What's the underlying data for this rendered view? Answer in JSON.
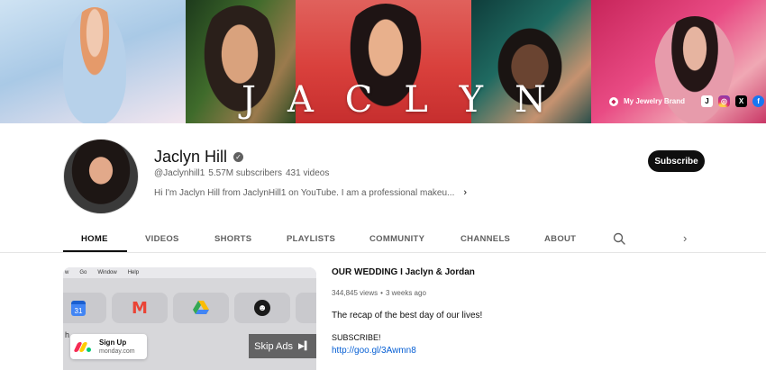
{
  "banner": {
    "word_letters": [
      "J",
      "A",
      "C",
      "L",
      "Y",
      "N"
    ],
    "jewelry_label": "My Jewelry Brand",
    "social_icons": [
      "jaclyn-cosmetics-icon",
      "instagram-icon",
      "x-icon",
      "facebook-icon"
    ]
  },
  "channel": {
    "name": "Jaclyn Hill",
    "handle": "@Jaclynhill1",
    "subscribers": "5.57M subscribers",
    "videos": "431 videos",
    "description": "Hi I'm Jaclyn Hill from JaclynHill1 on YouTube. I am a professional makeu...",
    "subscribe_label": "Subscribe"
  },
  "tabs": [
    {
      "label": "HOME"
    },
    {
      "label": "VIDEOS"
    },
    {
      "label": "SHORTS"
    },
    {
      "label": "PLAYLISTS"
    },
    {
      "label": "COMMUNITY"
    },
    {
      "label": "CHANNELS"
    },
    {
      "label": "ABOUT"
    }
  ],
  "player": {
    "menu": [
      "w",
      "Go",
      "Window",
      "Help"
    ],
    "calendar_day": "31",
    "ad_title": "Sign Up",
    "ad_domain": "monday.com",
    "skip_label": "Skip Ads",
    "partial_text": "h"
  },
  "featured": {
    "title": "OUR WEDDING I Jaclyn & Jordan",
    "views": "344,845 views",
    "separator": "•",
    "age": "3 weeks ago",
    "description": "The recap of the best day of our lives!",
    "subscribe_text": "SUBSCRIBE!",
    "link": "http://goo.gl/3Awmn8"
  },
  "colors": {
    "primary_text": "#0f0f0f",
    "secondary_text": "#606060",
    "link": "#065fd4",
    "subscribe_bg": "#0f0f0f"
  }
}
